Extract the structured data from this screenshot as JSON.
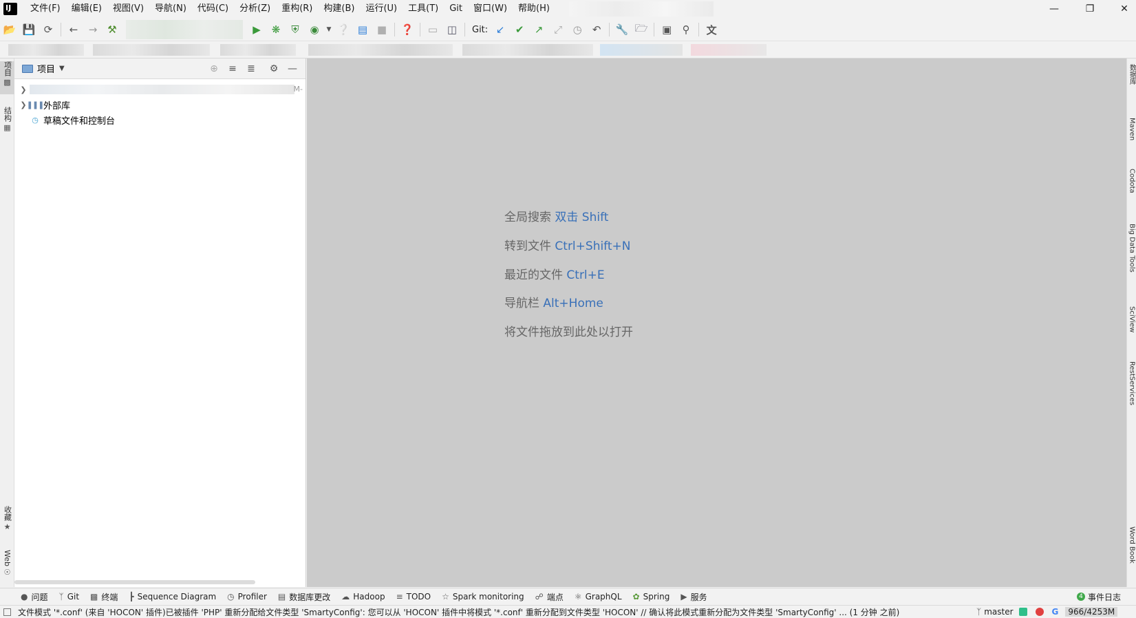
{
  "menu": [
    "文件(F)",
    "编辑(E)",
    "视图(V)",
    "导航(N)",
    "代码(C)",
    "分析(Z)",
    "重构(R)",
    "构建(B)",
    "运行(U)",
    "工具(T)",
    "Git",
    "窗口(W)",
    "帮助(H)"
  ],
  "window_controls": {
    "minimize": "—",
    "restore": "❐",
    "close": "✕"
  },
  "toolbar": {
    "git_label": "Git:"
  },
  "left_stripe": {
    "project": "项目",
    "structure": "结构",
    "favorites": "收藏",
    "web": "Web"
  },
  "project_panel": {
    "title": "项目",
    "root_suffix": "M-",
    "items": [
      {
        "label": "外部库"
      },
      {
        "label": "草稿文件和控制台"
      }
    ]
  },
  "editor_hints": [
    {
      "text": "全局搜索",
      "key": "双击 Shift"
    },
    {
      "text": "转到文件",
      "key": "Ctrl+Shift+N"
    },
    {
      "text": "最近的文件",
      "key": "Ctrl+E"
    },
    {
      "text": "导航栏",
      "key": "Alt+Home"
    },
    {
      "text": "将文件拖放到此处以打开",
      "key": ""
    }
  ],
  "right_stripe": [
    "数据库",
    "Maven",
    "Codota",
    "Big Data Tools",
    "SciView",
    "RestServices",
    "Word Book"
  ],
  "tool_windows": [
    {
      "label": "问题",
      "icon": "problems-icon"
    },
    {
      "label": "Git",
      "icon": "git-icon"
    },
    {
      "label": "终端",
      "icon": "terminal-icon"
    },
    {
      "label": "Sequence Diagram",
      "icon": "sequence-diagram-icon"
    },
    {
      "label": "Profiler",
      "icon": "profiler-icon"
    },
    {
      "label": "数据库更改",
      "icon": "database-changes-icon"
    },
    {
      "label": "Hadoop",
      "icon": "hadoop-icon"
    },
    {
      "label": "TODO",
      "icon": "todo-icon"
    },
    {
      "label": "Spark monitoring",
      "icon": "spark-icon"
    },
    {
      "label": "端点",
      "icon": "endpoints-icon"
    },
    {
      "label": "GraphQL",
      "icon": "graphql-icon"
    },
    {
      "label": "Spring",
      "icon": "spring-icon"
    },
    {
      "label": "服务",
      "icon": "services-icon"
    }
  ],
  "event_log": {
    "count": "4",
    "label": "事件日志"
  },
  "status": {
    "message": "文件模式 '*.conf' (来自 'HOCON' 插件)已被插件 'PHP' 重新分配给文件类型 'SmartyConfig': 您可以从 'HOCON' 插件中将模式 '*.conf' 重新分配到文件类型 'HOCON' // 确认将此模式重新分配为文件类型 'SmartyConfig' ... (1 分钟 之前)",
    "branch": "master",
    "memory": "966/4253M"
  },
  "colors": {
    "editor_bg": "#cbcbcb",
    "hint_key": "#3970b8",
    "hint_text": "#666666"
  }
}
